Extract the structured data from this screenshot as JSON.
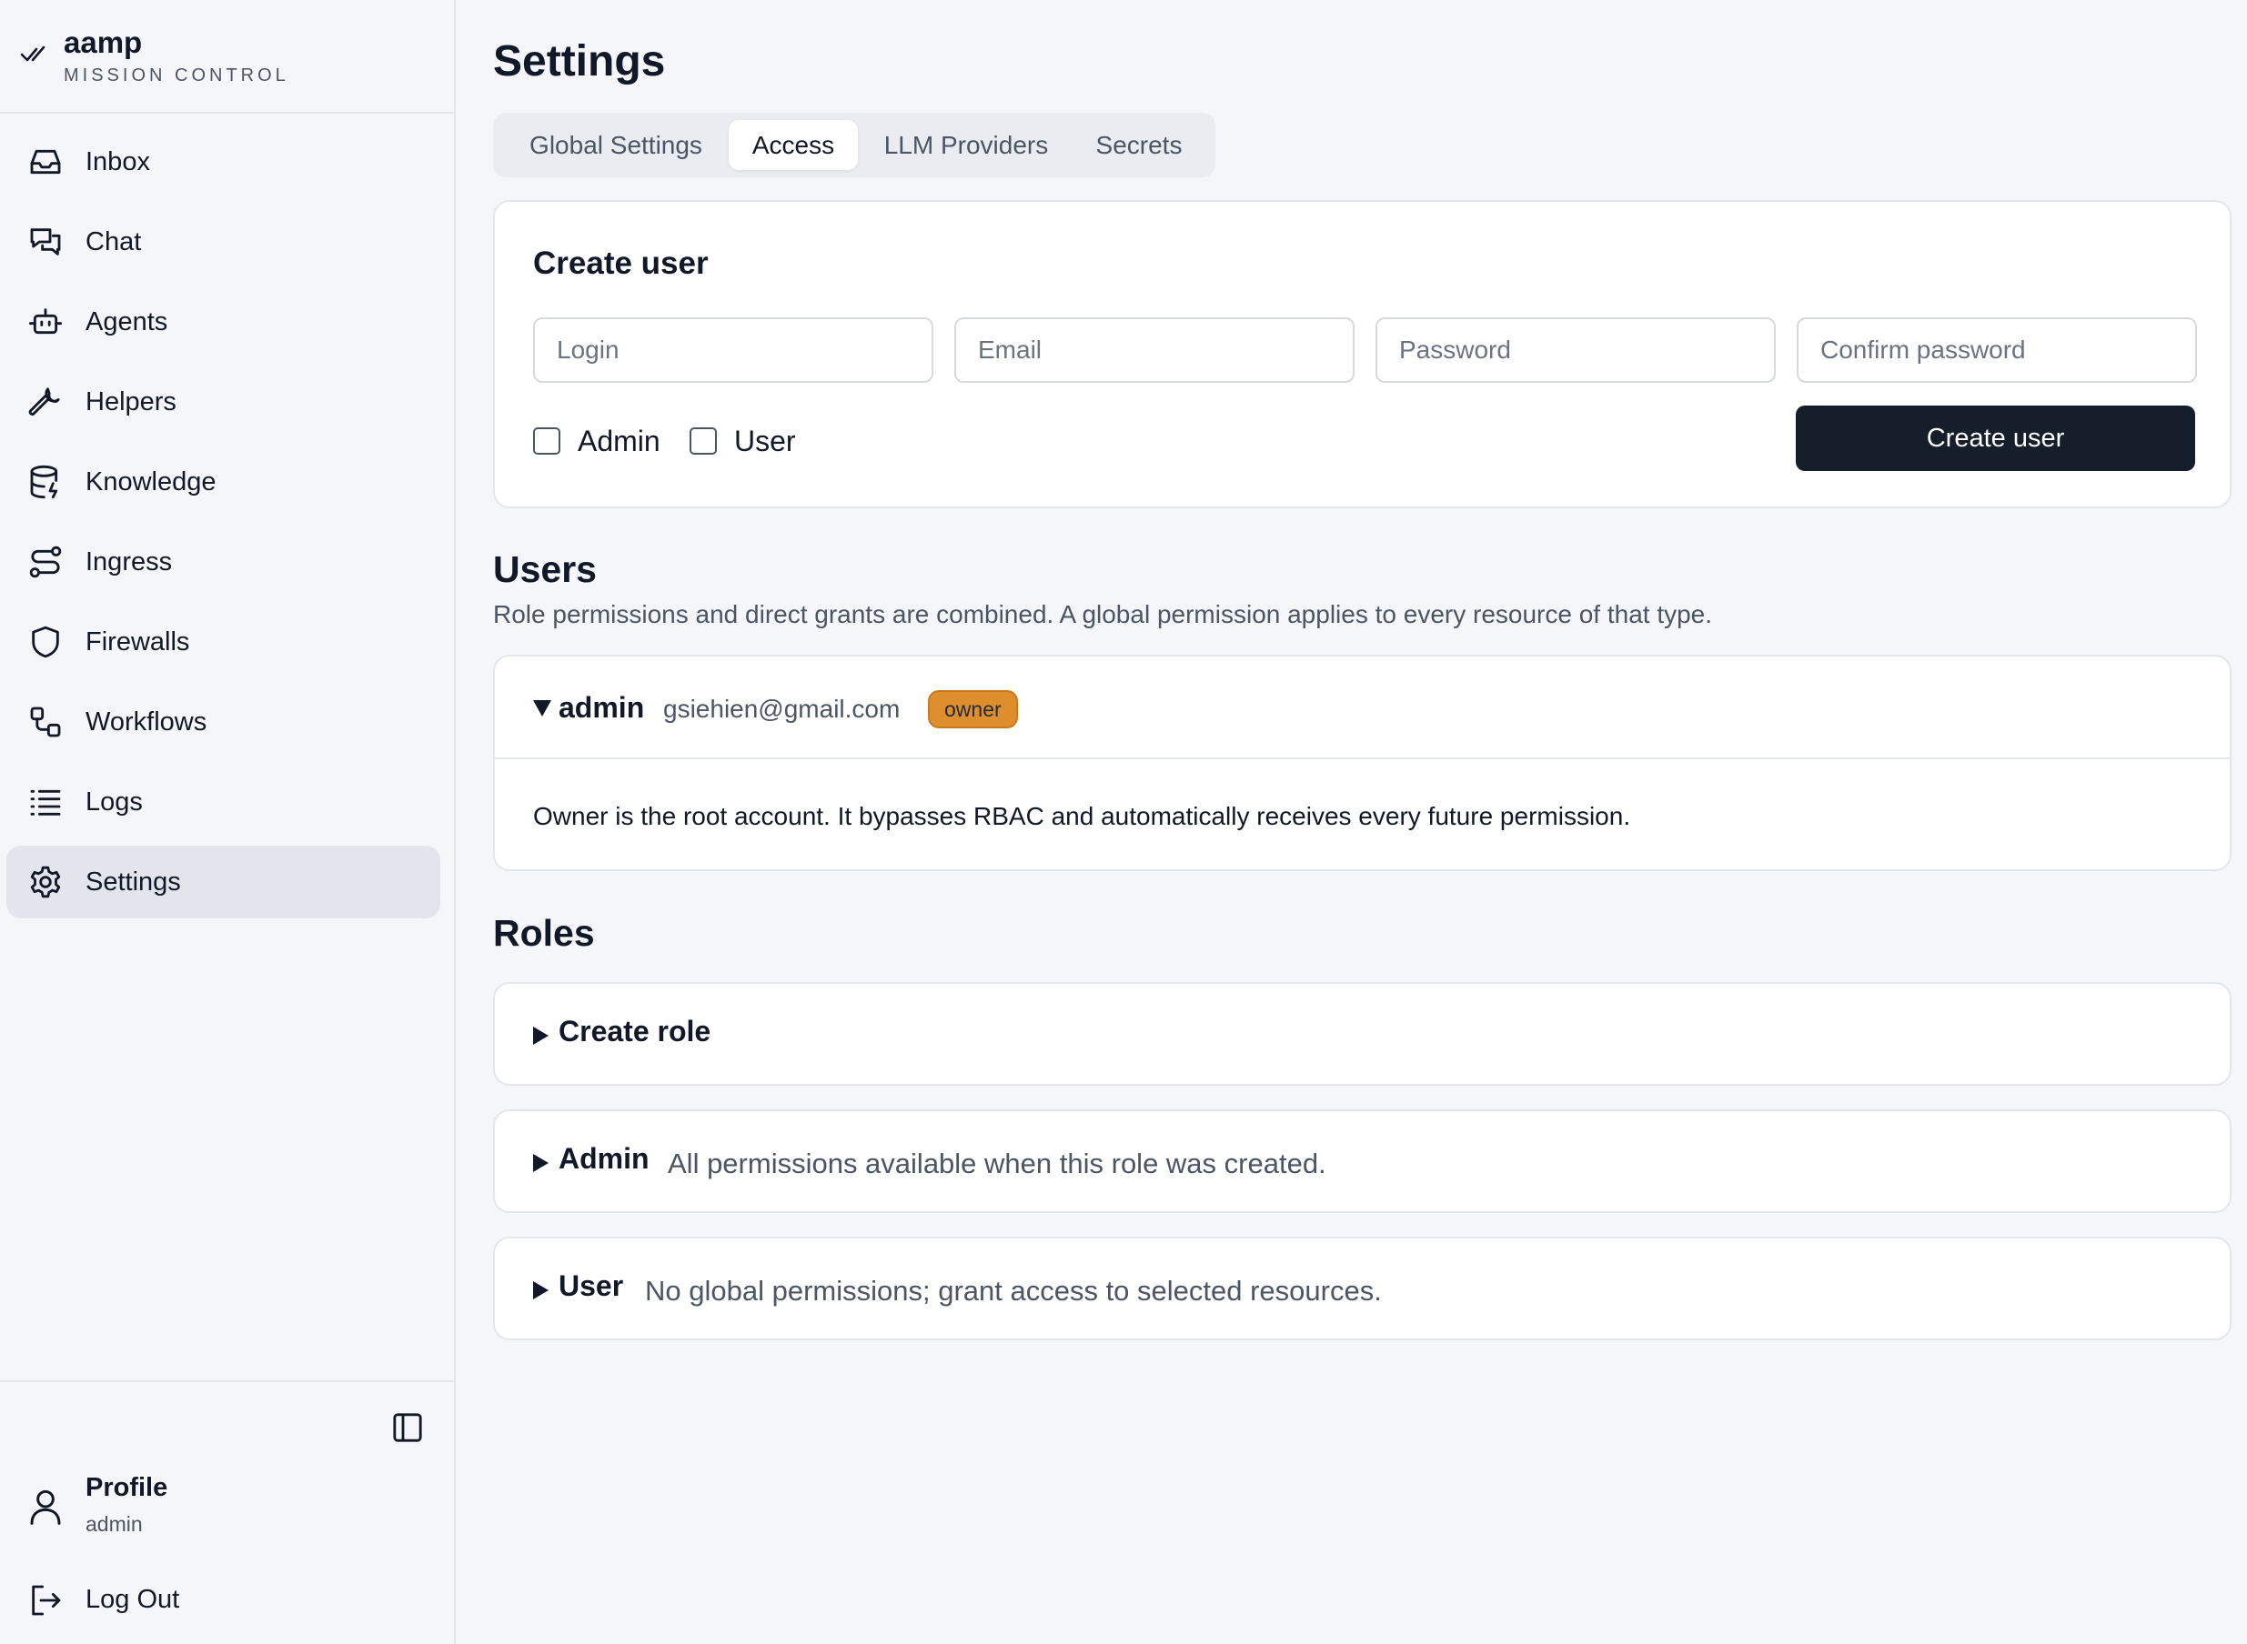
{
  "brand": {
    "name": "aamp",
    "subtitle": "MISSION CONTROL"
  },
  "sidebar": {
    "items": [
      {
        "label": "Inbox",
        "icon": "inbox-icon"
      },
      {
        "label": "Chat",
        "icon": "chat-icon"
      },
      {
        "label": "Agents",
        "icon": "bot-icon"
      },
      {
        "label": "Helpers",
        "icon": "wrench-icon"
      },
      {
        "label": "Knowledge",
        "icon": "database-icon"
      },
      {
        "label": "Ingress",
        "icon": "route-icon"
      },
      {
        "label": "Firewalls",
        "icon": "shield-icon"
      },
      {
        "label": "Workflows",
        "icon": "workflow-icon"
      },
      {
        "label": "Logs",
        "icon": "list-icon"
      },
      {
        "label": "Settings",
        "icon": "gear-icon",
        "active": true
      }
    ],
    "profile": {
      "title": "Profile",
      "subtitle": "admin"
    },
    "logout_label": "Log Out"
  },
  "page": {
    "title": "Settings"
  },
  "tabs": [
    {
      "label": "Global Settings"
    },
    {
      "label": "Access",
      "active": true
    },
    {
      "label": "LLM Providers"
    },
    {
      "label": "Secrets"
    }
  ],
  "create_user": {
    "title": "Create user",
    "fields": {
      "login_placeholder": "Login",
      "email_placeholder": "Email",
      "password_placeholder": "Password",
      "confirm_placeholder": "Confirm password"
    },
    "roles": [
      {
        "label": "Admin",
        "checked": false
      },
      {
        "label": "User",
        "checked": false
      }
    ],
    "submit_label": "Create user"
  },
  "users": {
    "title": "Users",
    "subtitle": "Role permissions and direct grants are combined. A global permission applies to every resource of that type.",
    "list": [
      {
        "name": "admin",
        "email": "gsiehien@gmail.com",
        "badge": "owner",
        "expanded": true,
        "description": "Owner is the root account. It bypasses RBAC and automatically receives every future permission."
      }
    ]
  },
  "roles": {
    "title": "Roles",
    "create_label": "Create role",
    "list": [
      {
        "name": "Admin",
        "description": "All permissions available when this role was created."
      },
      {
        "name": "User",
        "description": "No global permissions; grant access to selected resources."
      }
    ]
  },
  "colors": {
    "accent_dark": "#161e2b",
    "owner_badge": "#de8e2d",
    "background": "#f4f6f9",
    "active_nav": "#e2e6ec"
  }
}
